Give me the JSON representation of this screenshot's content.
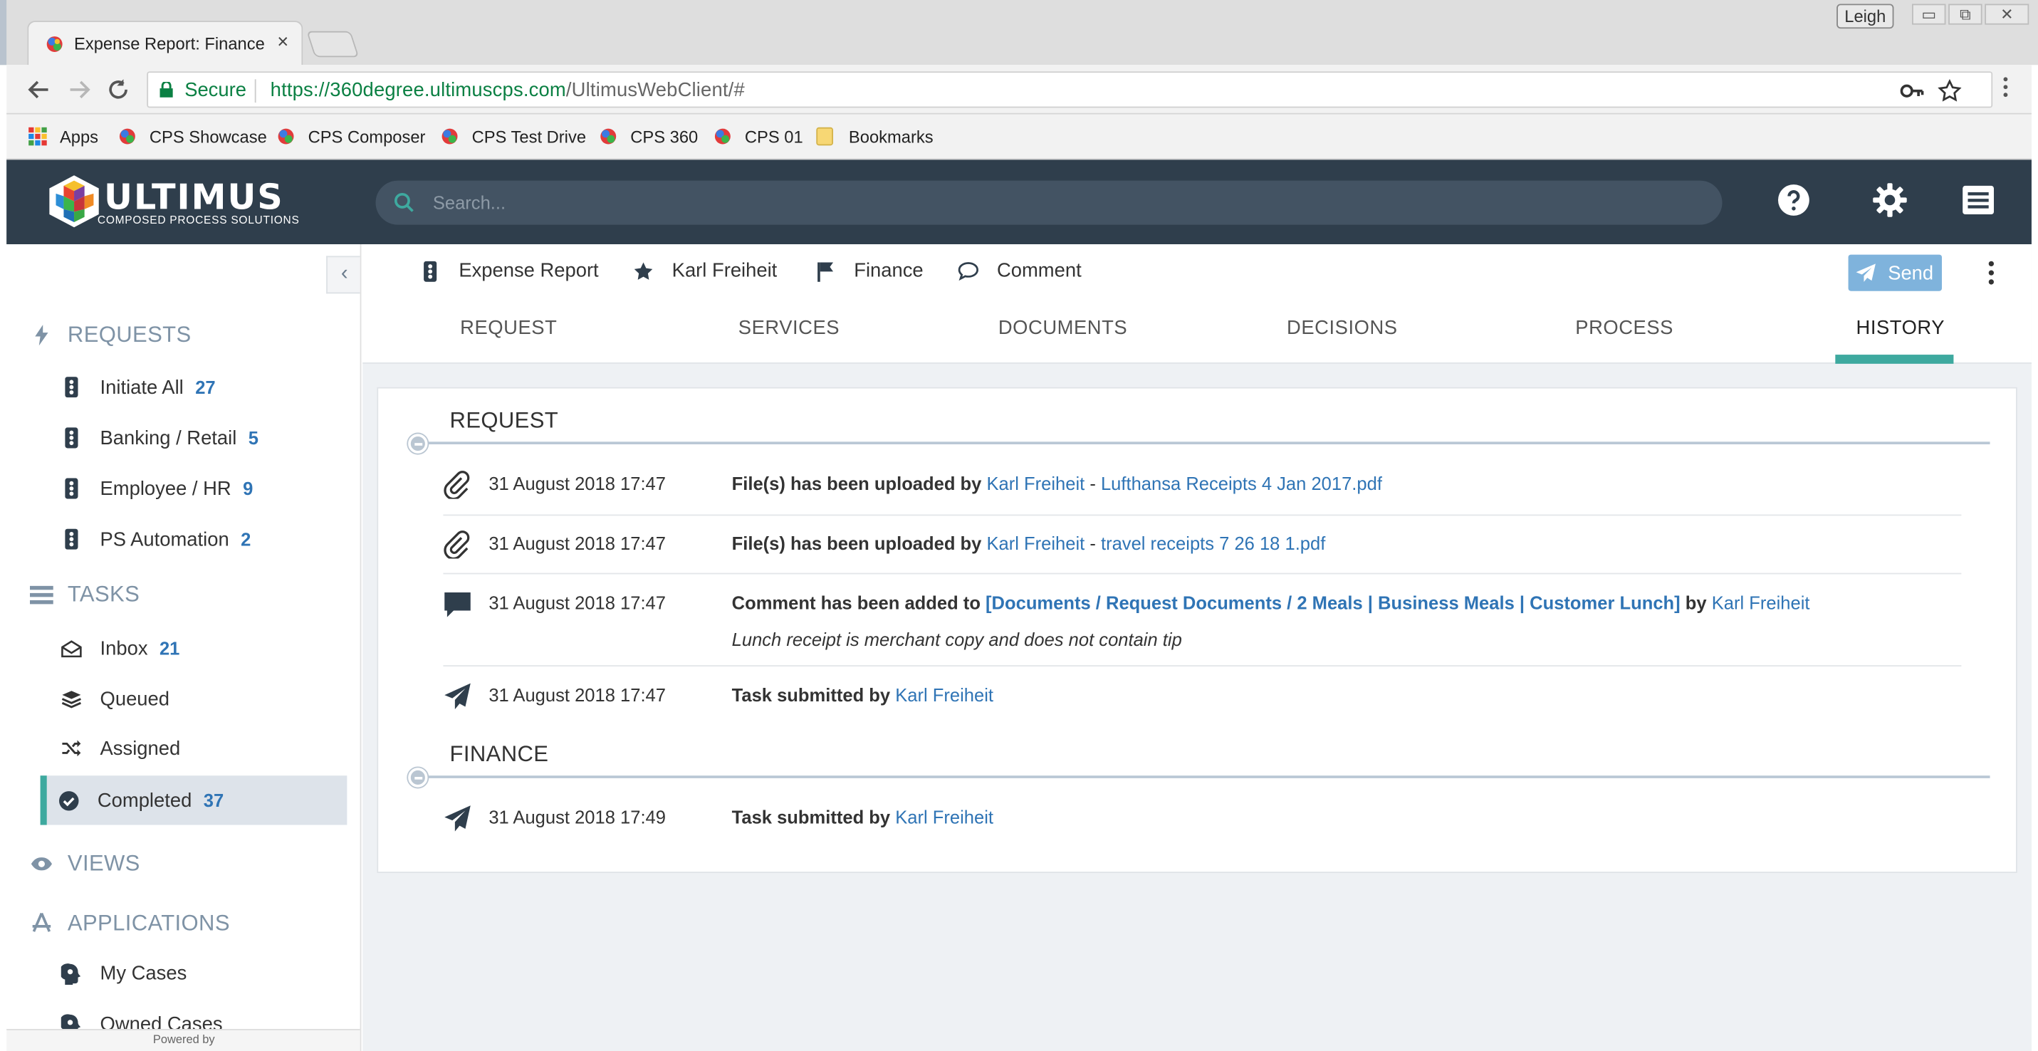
{
  "browser": {
    "tab_title": "Expense Report: Finance",
    "tab_close": "×",
    "user": "Leigh",
    "window_buttons": [
      "▭",
      "⧉",
      "✕"
    ],
    "secure_label": "Secure",
    "url_host": "https://360degree.ultimuscps.com",
    "url_path": "/UltimusWebClient/#",
    "bookmarks": [
      "Apps",
      "CPS Showcase",
      "CPS Composer",
      "CPS Test Drive",
      "CPS 360",
      "CPS 01",
      "Bookmarks"
    ]
  },
  "header": {
    "logo_text": "ULTIMUS",
    "logo_sub": "COMPOSED PROCESS SOLUTIONS",
    "search_placeholder": "Search..."
  },
  "sidebar": {
    "collapse_glyph": "‹",
    "requests_title": "REQUESTS",
    "requests": [
      {
        "label": "Initiate All",
        "count": "27"
      },
      {
        "label": "Banking / Retail",
        "count": "5"
      },
      {
        "label": "Employee / HR",
        "count": "9"
      },
      {
        "label": "PS Automation",
        "count": "2"
      }
    ],
    "tasks_title": "TASKS",
    "tasks": [
      {
        "label": "Inbox",
        "count": "21"
      },
      {
        "label": "Queued",
        "count": ""
      },
      {
        "label": "Assigned",
        "count": ""
      },
      {
        "label": "Completed",
        "count": "37"
      }
    ],
    "views_title": "VIEWS",
    "applications_title": "APPLICATIONS",
    "applications": [
      {
        "label": "My Cases"
      },
      {
        "label": "Owned Cases"
      }
    ],
    "powered_by": "Powered by"
  },
  "toolbar": {
    "process": "Expense Report",
    "user": "Karl Freiheit",
    "step": "Finance",
    "comment": "Comment",
    "send": "Send"
  },
  "tabs": [
    "REQUEST",
    "SERVICES",
    "DOCUMENTS",
    "DECISIONS",
    "PROCESS",
    "HISTORY"
  ],
  "history": {
    "groups": [
      {
        "title": "REQUEST",
        "events": [
          {
            "date": "31 August 2018 17:47",
            "action": "File(s) has been uploaded by",
            "user": "Karl Freiheit",
            "sep": "-",
            "file": "Lufthansa Receipts 4 Jan 2017.pdf"
          },
          {
            "date": "31 August 2018 17:47",
            "action": "File(s) has been uploaded by",
            "user": "Karl Freiheit",
            "sep": "-",
            "file": "travel receipts 7 26 18 1.pdf"
          },
          {
            "date": "31 August 2018 17:47",
            "action": "Comment has been added to",
            "target": "[Documents / Request Documents / 2 Meals | Business Meals | Customer Lunch]",
            "by": "by",
            "user": "Karl Freiheit",
            "comment": "Lunch receipt is merchant copy and does not contain tip"
          },
          {
            "date": "31 August 2018 17:47",
            "action": "Task submitted by",
            "user": "Karl Freiheit"
          }
        ]
      },
      {
        "title": "FINANCE",
        "events": [
          {
            "date": "31 August 2018 17:49",
            "action": "Task submitted by",
            "user": "Karl Freiheit"
          }
        ]
      }
    ]
  },
  "colors": {
    "accent": "#3ea99f",
    "header": "#2f3e4c",
    "link": "#2f74b5",
    "send": "#7fb3dc"
  }
}
